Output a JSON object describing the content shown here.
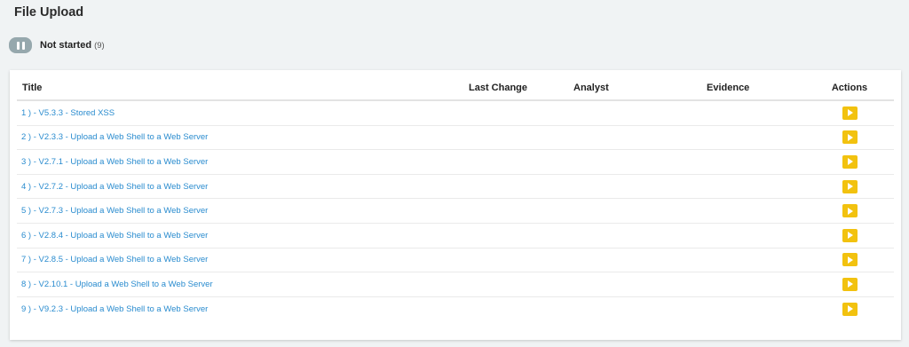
{
  "page": {
    "title": "File Upload"
  },
  "status": {
    "label": "Not started",
    "count": "(9)",
    "button_icon": "pause-icon",
    "button_color": "#96a8ad"
  },
  "table": {
    "headers": {
      "title": "Title",
      "last_change": "Last Change",
      "analyst": "Analyst",
      "evidence": "Evidence",
      "actions": "Actions"
    },
    "rows": [
      {
        "title": "1 ) - V5.3.3 - Stored XSS",
        "last_change": "",
        "analyst": "",
        "evidence": ""
      },
      {
        "title": "2 ) - V2.3.3 - Upload a Web Shell to a Web Server",
        "last_change": "",
        "analyst": "",
        "evidence": ""
      },
      {
        "title": "3 ) - V2.7.1 - Upload a Web Shell to a Web Server",
        "last_change": "",
        "analyst": "",
        "evidence": ""
      },
      {
        "title": "4 ) - V2.7.2 - Upload a Web Shell to a Web Server",
        "last_change": "",
        "analyst": "",
        "evidence": ""
      },
      {
        "title": "5 ) - V2.7.3 - Upload a Web Shell to a Web Server",
        "last_change": "",
        "analyst": "",
        "evidence": ""
      },
      {
        "title": "6 ) - V2.8.4 - Upload a Web Shell to a Web Server",
        "last_change": "",
        "analyst": "",
        "evidence": ""
      },
      {
        "title": "7 ) - V2.8.5 - Upload a Web Shell to a Web Server",
        "last_change": "",
        "analyst": "",
        "evidence": ""
      },
      {
        "title": "8 ) - V2.10.1 - Upload a Web Shell to a Web Server",
        "last_change": "",
        "analyst": "",
        "evidence": ""
      },
      {
        "title": "9 ) - V9.2.3 - Upload a Web Shell to a Web Server",
        "last_change": "",
        "analyst": "",
        "evidence": ""
      }
    ],
    "action_icon": "play-icon",
    "action_color": "#f2c20f",
    "link_color": "#2a8ccf"
  }
}
